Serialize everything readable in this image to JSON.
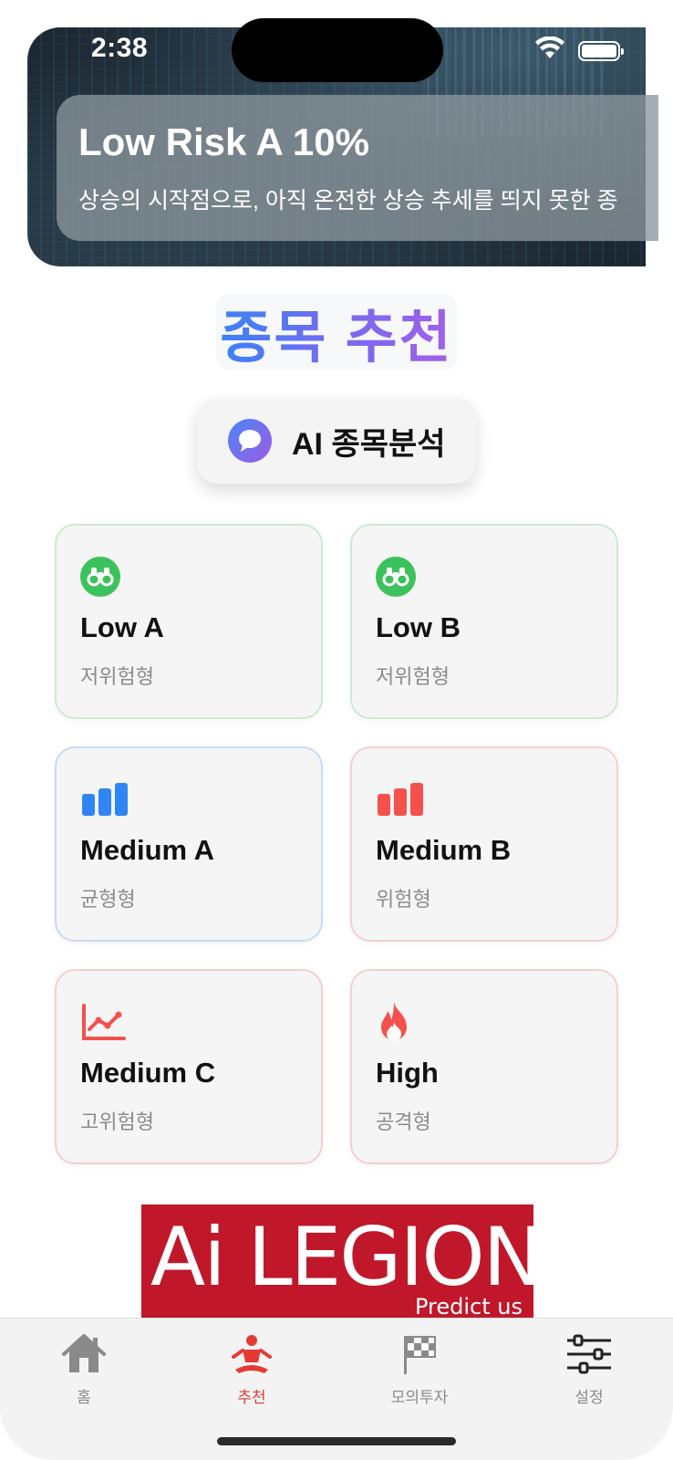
{
  "status_bar": {
    "time": "2:38"
  },
  "hero": {
    "title": "Low Risk A 10%",
    "description": "상승의 시작점으로, 아직 온전한 상승 추세를 띄지 못한 종"
  },
  "section": {
    "title": "종목 추천"
  },
  "ai_button": {
    "label": "AI 종목분석",
    "icon": "chat-bubble-icon"
  },
  "portfolio_cards": [
    {
      "title": "Low A",
      "subtitle": "저위험형",
      "icon": "binoculars-icon",
      "color": "#3cc25c"
    },
    {
      "title": "Low B",
      "subtitle": "저위험형",
      "icon": "binoculars-icon",
      "color": "#3cc25c"
    },
    {
      "title": "Medium A",
      "subtitle": "균형형",
      "icon": "bar-chart-icon",
      "color": "#2f86f3"
    },
    {
      "title": "Medium B",
      "subtitle": "위험형",
      "icon": "bar-chart-icon",
      "color": "#f4514c"
    },
    {
      "title": "Medium C",
      "subtitle": "고위험형",
      "icon": "line-chart-icon",
      "color": "#f4514c"
    },
    {
      "title": "High",
      "subtitle": "공격형",
      "icon": "flame-icon",
      "color": "#f4514c"
    }
  ],
  "logo": {
    "main": "Ai LEGION",
    "tagline": "Predict us"
  },
  "tabbar": {
    "items": [
      {
        "label": "홈",
        "icon": "house-icon",
        "active": false
      },
      {
        "label": "추천",
        "icon": "meditation-figure-icon",
        "active": true
      },
      {
        "label": "모의투자",
        "icon": "checkered-flag-icon",
        "active": false
      },
      {
        "label": "설정",
        "icon": "sliders-icon",
        "active": false
      }
    ]
  },
  "colors": {
    "accent_red": "#e53935",
    "title_gradient_start": "#3b82f6",
    "title_gradient_end": "#a35ee8",
    "logo_background": "#c0182a"
  }
}
